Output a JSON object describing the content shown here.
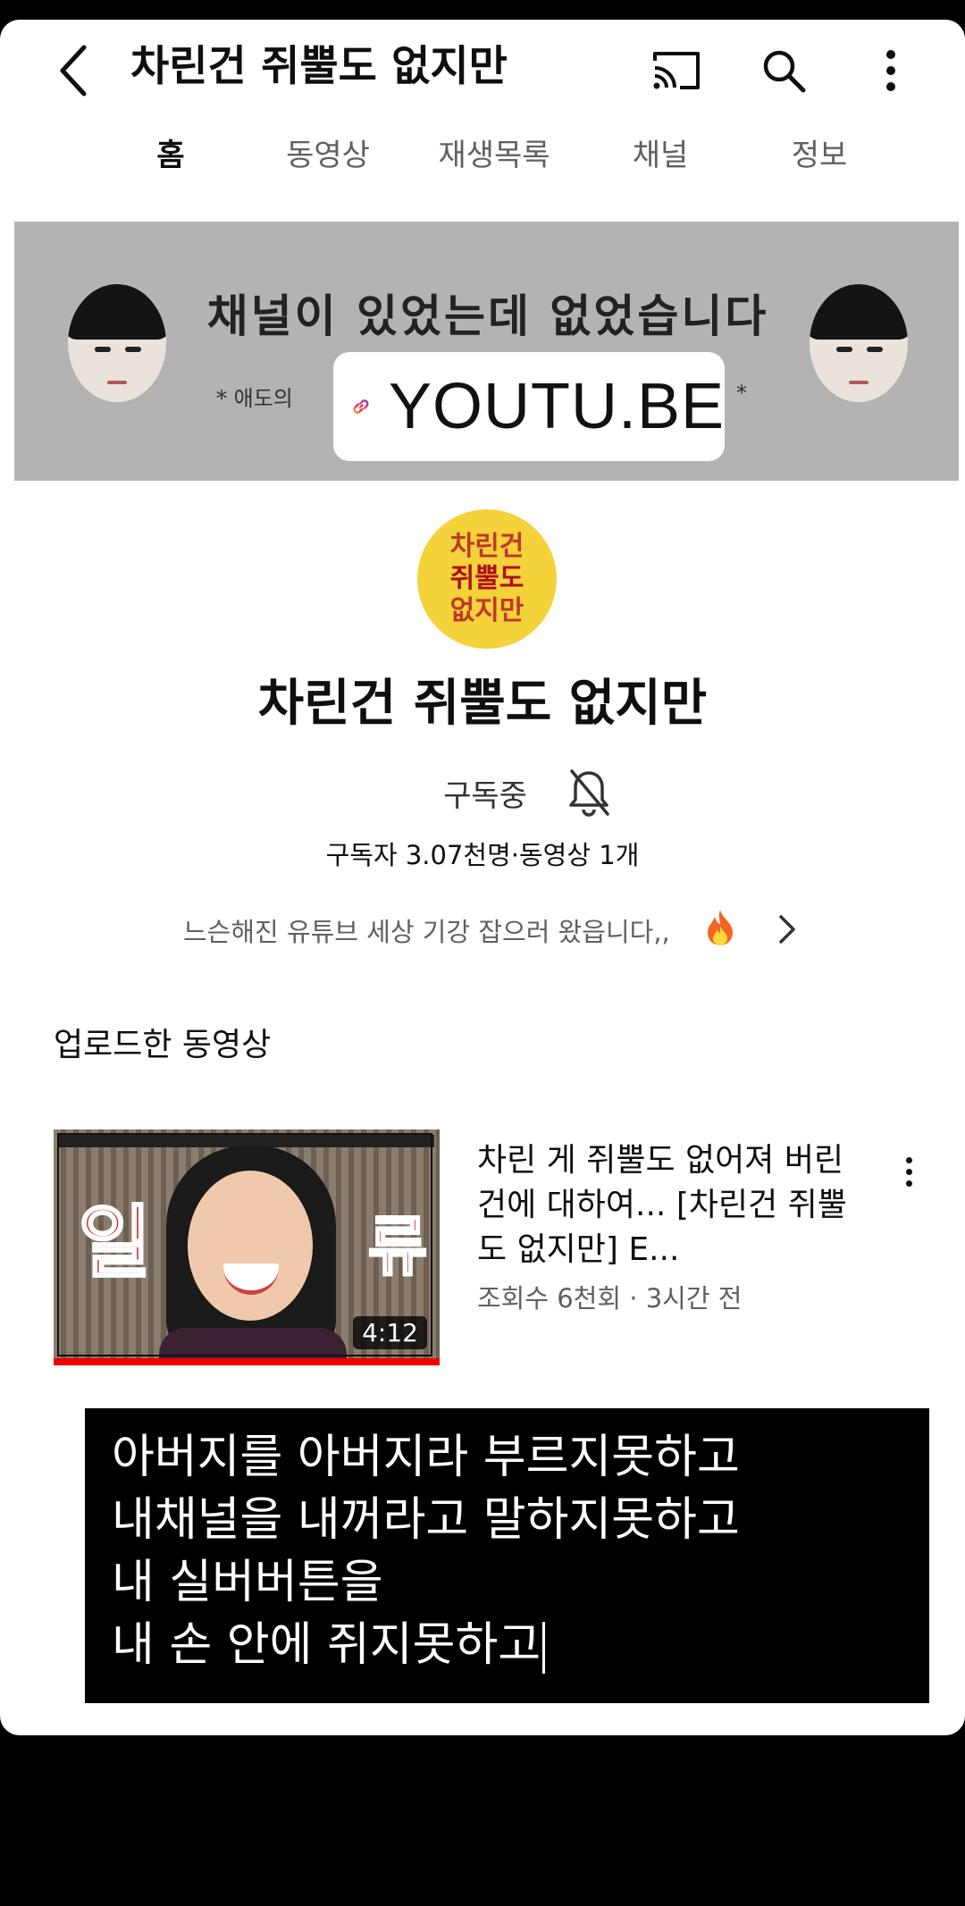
{
  "header": {
    "title": "차린건 쥐뿔도 없지만"
  },
  "tabs": [
    {
      "label": "홈",
      "active": true
    },
    {
      "label": "동영상",
      "active": false
    },
    {
      "label": "재생목록",
      "active": false
    },
    {
      "label": "채널",
      "active": false
    },
    {
      "label": "정보",
      "active": false
    }
  ],
  "banner": {
    "headline": "채널이 있었는데 없었습니다",
    "subline": "* 애도의",
    "star": "*"
  },
  "link_sticker": {
    "label": "YOUTU.BE"
  },
  "channel": {
    "avatar_lines": [
      "차린건",
      "쥐뿔도",
      "없지만"
    ],
    "name": "차린건 쥐뿔도 없지만",
    "subscribe_label": "구독중",
    "stats": "구독자 3.07천명·동영상 1개",
    "description": "느슨해진 유튜브 세상 기강 잡으러 왔읍니다,,"
  },
  "uploads": {
    "section_title": "업로드한 동영상",
    "videos": [
      {
        "title": "차린 게 쥐뿔도 없어져 버린 건에 대하여...  [차린건 쥐뿔도 없지만] E...",
        "meta": "조회수 6천회 · 3시간 전",
        "duration": "4:12",
        "thumb_left_char": "일",
        "thumb_right_char": "류"
      }
    ]
  },
  "caption": {
    "lines": [
      "아버지를 아버지라 부르지못하고",
      "내채널을 내꺼라고 말하지못하고",
      "내 실버버튼을",
      "내 손 안에 쥐지못하고"
    ]
  },
  "colors": {
    "banner_bg": "#b3b3b3",
    "avatar_bg": "#f3d23a",
    "progress_red": "#e00000"
  }
}
